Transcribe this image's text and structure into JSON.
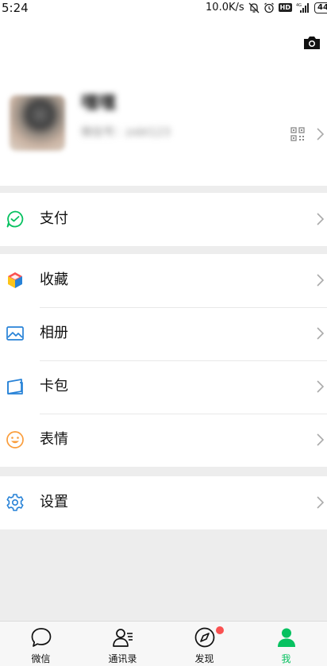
{
  "status_bar": {
    "time": "5:24",
    "net_speed": "10.0K/s",
    "hd_label": "HD",
    "battery": "44",
    "icons": [
      "mute-bell-icon",
      "alarm-icon",
      "hd-icon",
      "4g-signal-icon",
      "battery-icon"
    ]
  },
  "profile": {
    "nickname": "嘿嘿",
    "wechat_id": "微信号：zxbt123"
  },
  "menu": {
    "pay": {
      "label": "支付",
      "icon": "pay-icon",
      "color": "#07c160"
    },
    "favorites": {
      "label": "收藏",
      "icon": "favorites-cube-icon"
    },
    "album": {
      "label": "相册",
      "icon": "album-icon",
      "color": "#2782d7"
    },
    "cards": {
      "label": "卡包",
      "icon": "card-wallet-icon",
      "color": "#2782d7"
    },
    "stickers": {
      "label": "表情",
      "icon": "smiley-icon",
      "color": "#fa9d3b"
    },
    "settings": {
      "label": "设置",
      "icon": "gear-icon",
      "color": "#2782d7"
    }
  },
  "tabbar": {
    "tabs": [
      {
        "label": "微信",
        "icon": "chat-bubble-icon"
      },
      {
        "label": "通讯录",
        "icon": "contacts-icon"
      },
      {
        "label": "发现",
        "icon": "compass-icon"
      },
      {
        "label": "我",
        "icon": "person-icon",
        "active": true
      }
    ],
    "active_color": "#07c160",
    "badge_color": "#fa5151"
  }
}
